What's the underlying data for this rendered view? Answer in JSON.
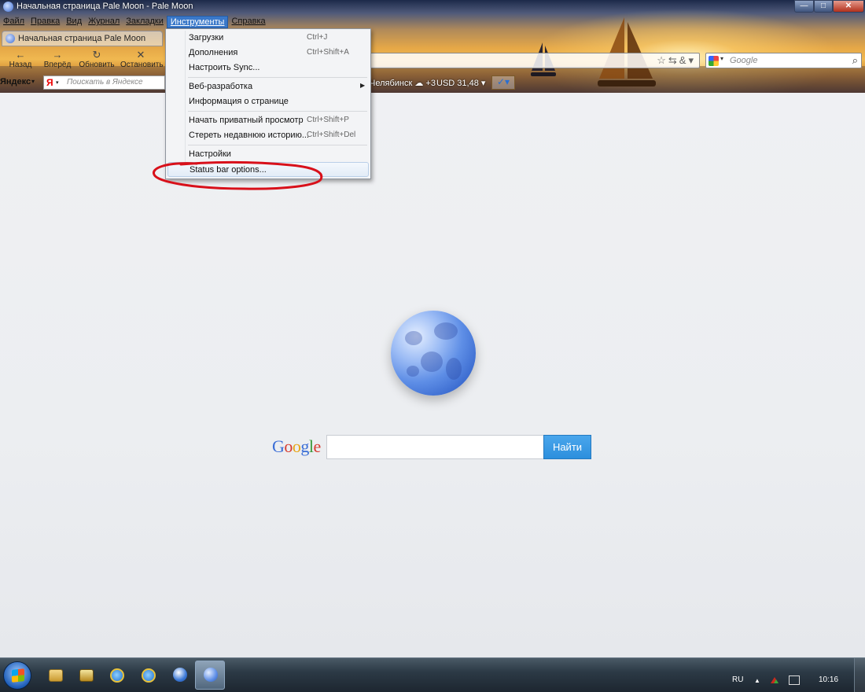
{
  "window": {
    "title": "Начальная страница Pale Moon - Pale Moon",
    "controls": {
      "minimize": "—",
      "maximize": "□",
      "close": "✕"
    }
  },
  "menubar": {
    "items": [
      {
        "label": "Файл"
      },
      {
        "label": "Правка"
      },
      {
        "label": "Вид"
      },
      {
        "label": "Журнал"
      },
      {
        "label": "Закладки"
      },
      {
        "label": "Инструменты",
        "active": true
      },
      {
        "label": "Справка"
      }
    ]
  },
  "tab": {
    "title": "Начальная страница Pale Moon"
  },
  "nav": {
    "back": {
      "label": "Назад",
      "icon": "←"
    },
    "forward": {
      "label": "Вперёд",
      "icon": "→"
    },
    "reload": {
      "label": "Обновить",
      "icon": "↻"
    },
    "stop": {
      "label": "Остановить",
      "icon": "✕"
    }
  },
  "urlbar": {
    "icons": "☆⇆&▾"
  },
  "search": {
    "placeholder": "Google",
    "dropdown": "▾",
    "go_icon": "⌕"
  },
  "yandexbar": {
    "logo": "Яндекс",
    "dropdown": "▾",
    "search_icon": "Я",
    "search_dropdown": "▾",
    "search_placeholder": "Поискать в Яндексе",
    "weather": "Челябинск ☁ +3",
    "currency": "USD 31,48 ▾",
    "check": "✓▾"
  },
  "tools_menu": {
    "groups": [
      [
        {
          "label": "Загрузки",
          "shortcut": "Ctrl+J"
        },
        {
          "label": "Дополнения",
          "shortcut": "Ctrl+Shift+A"
        },
        {
          "label": "Настроить Sync...",
          "shortcut": ""
        }
      ],
      [
        {
          "label": "Веб-разработка",
          "shortcut": "",
          "submenu": true
        },
        {
          "label": "Информация о странице",
          "shortcut": ""
        }
      ],
      [
        {
          "label": "Начать приватный просмотр",
          "shortcut": "Ctrl+Shift+P"
        },
        {
          "label": "Стереть недавнюю историю...",
          "shortcut": "Ctrl+Shift+Del"
        }
      ],
      [
        {
          "label": "Настройки",
          "shortcut": ""
        },
        {
          "label": "Status bar options...",
          "shortcut": "",
          "highlighted": true
        }
      ]
    ],
    "submenu_arrow": "▶"
  },
  "content": {
    "google_logo": [
      {
        "ch": "G",
        "color": "#3b6ed6"
      },
      {
        "ch": "o",
        "color": "#d63b2f"
      },
      {
        "ch": "o",
        "color": "#e8a515"
      },
      {
        "ch": "g",
        "color": "#3b6ed6"
      },
      {
        "ch": "l",
        "color": "#3a9a3a"
      },
      {
        "ch": "e",
        "color": "#d63b2f"
      }
    ],
    "search_button": "Найти"
  },
  "taskbar": {
    "lang": "RU",
    "tray_arrow": "▲",
    "time": "10:16"
  },
  "colors": {
    "annotation": "#d8101a",
    "accent": "#2c8fdd",
    "menu_active": "#3a78c9"
  }
}
